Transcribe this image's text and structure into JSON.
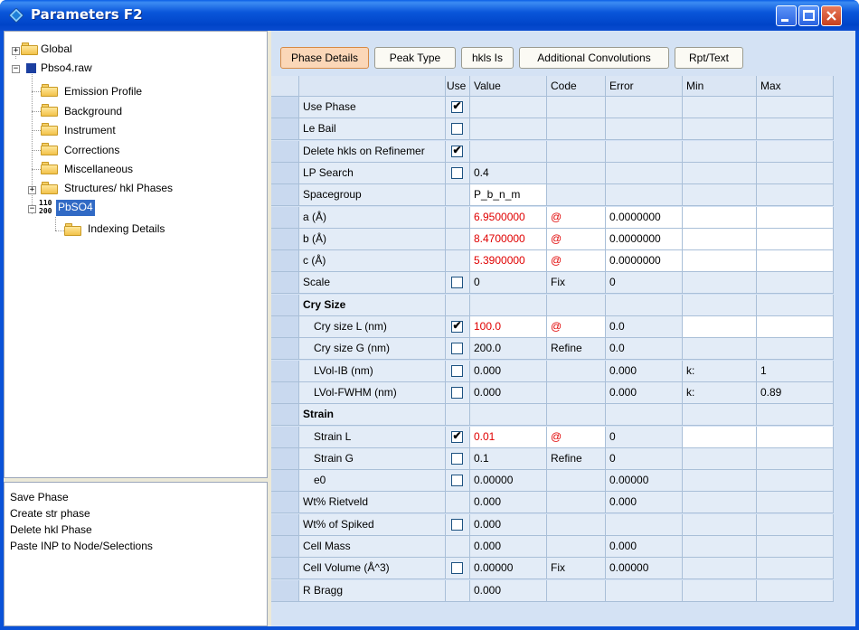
{
  "window": {
    "title": "Parameters F2"
  },
  "tree": {
    "global": "Global",
    "file": "Pbso4.raw",
    "emission_profile": "Emission Profile",
    "background": "Background",
    "instrument": "Instrument",
    "corrections": "Corrections",
    "miscellaneous": "Miscellaneous",
    "structures": "Structures/ hkl Phases",
    "phase_badge_top": "110",
    "phase_badge_bottom": "200",
    "phase": "PbSO4",
    "indexing_details": "Indexing Details"
  },
  "actions": [
    "Save Phase",
    "Create str phase",
    "Delete hkl Phase",
    "Paste INP to Node/Selections"
  ],
  "tabs": [
    "Phase Details",
    "Peak Type",
    "hkls Is",
    "Additional Convolutions",
    "Rpt/Text"
  ],
  "grid": {
    "headers": [
      "",
      "Use",
      "Value",
      "Code",
      "Error",
      "Min",
      "Max"
    ],
    "rows": [
      {
        "name": "Use Phase",
        "use": true,
        "value": "",
        "code": "",
        "error": "",
        "min": "",
        "max": ""
      },
      {
        "name": "Le Bail",
        "use": false,
        "value": "",
        "code": "",
        "error": "",
        "min": "",
        "max": ""
      },
      {
        "name": "Delete hkls on Refinemer",
        "use": true,
        "value": "",
        "code": "",
        "error": "",
        "min": "",
        "max": ""
      },
      {
        "name": "LP Search",
        "use": false,
        "value": "0.4",
        "code": "",
        "error": "",
        "min": "",
        "max": ""
      },
      {
        "name": "Spacegroup",
        "use": null,
        "value": "P_b_n_m",
        "code": "",
        "error": "",
        "min": "",
        "max": ""
      },
      {
        "name": "a (Å)",
        "use": null,
        "value": "6.9500000",
        "code": "@",
        "error": "0.0000000",
        "min": "",
        "max": ""
      },
      {
        "name": "b (Å)",
        "use": null,
        "value": "8.4700000",
        "code": "@",
        "error": "0.0000000",
        "min": "",
        "max": ""
      },
      {
        "name": "c (Å)",
        "use": null,
        "value": "5.3900000",
        "code": "@",
        "error": "0.0000000",
        "min": "",
        "max": ""
      },
      {
        "name": "Scale",
        "use": false,
        "value": "0",
        "code": "Fix",
        "error": "0",
        "min": "",
        "max": ""
      },
      {
        "name": "Cry Size",
        "use": null,
        "value": "",
        "code": "",
        "error": "",
        "min": "",
        "max": ""
      },
      {
        "name": "Cry size L (nm)",
        "use": true,
        "value": "100.0",
        "code": "@",
        "error": "0.0",
        "min": "",
        "max": ""
      },
      {
        "name": "Cry size G (nm)",
        "use": false,
        "value": "200.0",
        "code": "Refine",
        "error": "0.0",
        "min": "",
        "max": ""
      },
      {
        "name": "LVol-IB (nm)",
        "use": false,
        "value": "0.000",
        "code": "",
        "error": "0.000",
        "min": "k:",
        "max": "1"
      },
      {
        "name": "LVol-FWHM (nm)",
        "use": false,
        "value": "0.000",
        "code": "",
        "error": "0.000",
        "min": "k:",
        "max": "0.89"
      },
      {
        "name": "Strain",
        "use": null,
        "value": "",
        "code": "",
        "error": "",
        "min": "",
        "max": ""
      },
      {
        "name": "Strain L",
        "use": true,
        "value": "0.01",
        "code": "@",
        "error": "0",
        "min": "",
        "max": ""
      },
      {
        "name": "Strain G",
        "use": false,
        "value": "0.1",
        "code": "Refine",
        "error": "0",
        "min": "",
        "max": ""
      },
      {
        "name": "e0",
        "use": false,
        "value": "0.00000",
        "code": "",
        "error": "0.00000",
        "min": "",
        "max": ""
      },
      {
        "name": "Wt% Rietveld",
        "use": null,
        "value": "0.000",
        "code": "",
        "error": "0.000",
        "min": "",
        "max": ""
      },
      {
        "name": "Wt% of Spiked",
        "use": false,
        "value": "0.000",
        "code": "",
        "error": "",
        "min": "",
        "max": ""
      },
      {
        "name": "Cell Mass",
        "use": null,
        "value": "0.000",
        "code": "",
        "error": "0.000",
        "min": "",
        "max": ""
      },
      {
        "name": "Cell Volume (Å^3)",
        "use": false,
        "value": "0.00000",
        "code": "Fix",
        "error": "0.00000",
        "min": "",
        "max": ""
      },
      {
        "name": "R Bragg",
        "use": null,
        "value": "0.000",
        "code": "",
        "error": "",
        "min": "",
        "max": ""
      }
    ]
  },
  "colors": {
    "title_bar": "#0a52d8",
    "active_tab": "#fbd7b8",
    "refined_value": "#e00000",
    "grid_bg": "#e3ecf7"
  }
}
